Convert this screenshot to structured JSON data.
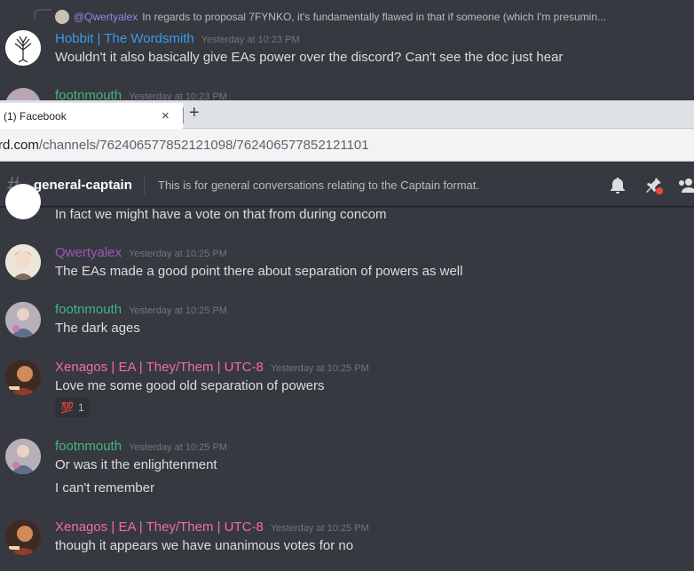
{
  "top_messages": {
    "reply": {
      "mention": "@Qwertyalex",
      "snippet": "In regards to proposal 7FYNKO, it's fundamentally flawed in that if someone (which I'm presumin..."
    },
    "message1": {
      "username": "Hobbit | The Wordsmith",
      "username_color": "#3b9bec",
      "timestamp": "Yesterday at 10:23 PM",
      "text": "Wouldn't it also basically give EAs power over the discord? Can't see the doc just hear"
    },
    "message2": {
      "username": "footnmouth",
      "username_color": "#43b581",
      "timestamp": "Yesterday at 10:23 PM"
    }
  },
  "browser": {
    "tab_title": "(1) Facebook",
    "close_glyph": "×",
    "new_tab_glyph": "+",
    "url_host": "rd.com",
    "url_path": "/channels/762406577852121098/762406577852121101"
  },
  "channel": {
    "hash": "#",
    "name": "general-captain",
    "topic": "This is for general conversations relating to the Captain format.",
    "icons": [
      "bell-icon",
      "pin-icon",
      "members-icon"
    ]
  },
  "messages": [
    {
      "text": "In fact we might have a vote on that from during concom"
    },
    {
      "username": "Qwertyalex",
      "username_color": "#9b59b6",
      "timestamp": "Yesterday at 10:25 PM",
      "text": "The EAs made a good point there about separation of powers as well"
    },
    {
      "username": "footnmouth",
      "username_color": "#43b581",
      "timestamp": "Yesterday at 10:25 PM",
      "text": "The dark ages"
    },
    {
      "username": "Xenagos | EA | They/Them | UTC-8",
      "username_color": "#f26bad",
      "timestamp": "Yesterday at 10:25 PM",
      "text": "Love me some good old separation of powers",
      "reaction": {
        "emoji": "💯",
        "count": "1"
      }
    },
    {
      "username": "footnmouth",
      "username_color": "#43b581",
      "timestamp": "Yesterday at 10:25 PM",
      "text": "Or was it the enlightenment",
      "text2": "I can't remember"
    },
    {
      "username": "Xenagos | EA | They/Them | UTC-8",
      "username_color": "#f26bad",
      "timestamp": "Yesterday at 10:25 PM",
      "text": "though it appears we have unanimous votes for no"
    }
  ]
}
